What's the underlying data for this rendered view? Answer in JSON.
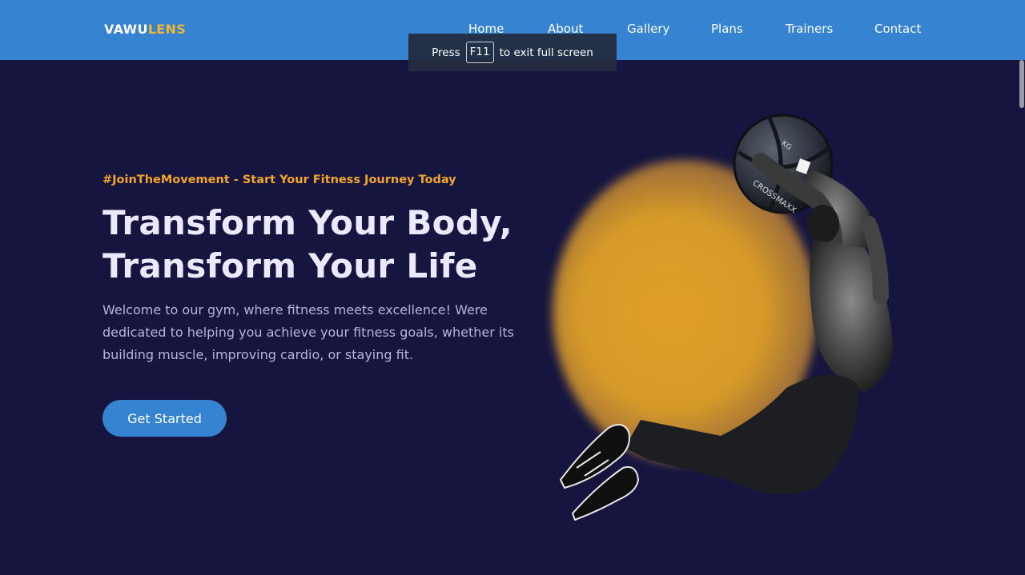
{
  "brand": {
    "prefix": "VAWU",
    "accent": "LENS"
  },
  "nav": {
    "items": [
      {
        "label": "Home"
      },
      {
        "label": "About"
      },
      {
        "label": "Gallery"
      },
      {
        "label": "Plans"
      },
      {
        "label": "Trainers"
      },
      {
        "label": "Contact"
      }
    ]
  },
  "fullscreen_banner": {
    "before": "Press",
    "key": "F11",
    "after": "to exit full screen"
  },
  "hero": {
    "tagline": "#JoinTheMovement - Start Your Fitness Journey Today",
    "title_line1": "Transform Your Body,",
    "title_line2": "Transform Your Life",
    "description": "Welcome to our gym, where fitness meets excellence! Were dedicated to helping you achieve your fitness goals, whether its building muscle, improving cardio, or staying fit.",
    "cta_label": "Get Started"
  },
  "medicine_ball": {
    "text": "CROSSMAXX",
    "weight": "KG"
  },
  "colors": {
    "navbar": "#3583d1",
    "background": "#15153f",
    "accent_orange": "#f2a52e",
    "logo_accent": "#f2b632",
    "button": "#3583d1"
  }
}
